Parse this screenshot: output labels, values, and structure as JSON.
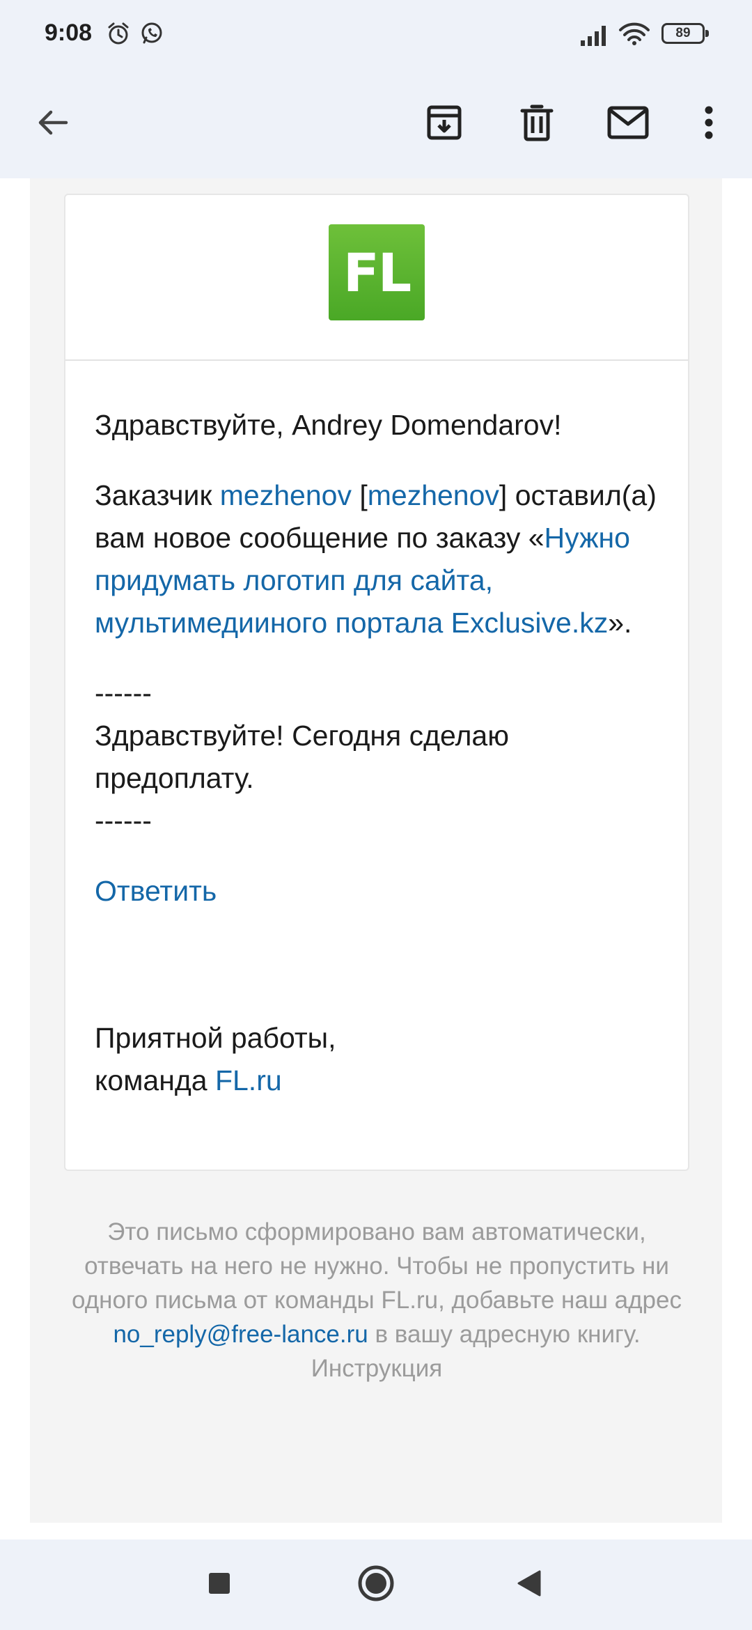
{
  "status_bar": {
    "time": "9:08",
    "battery": "89",
    "icons": [
      "alarm-icon",
      "whatsapp-icon",
      "signal-icon",
      "wifi-icon",
      "battery-icon"
    ]
  },
  "app_bar": {
    "icons": [
      "back-arrow-icon",
      "archive-icon",
      "delete-icon",
      "mark-unread-icon",
      "more-vert-icon"
    ]
  },
  "email": {
    "logo_text": "FL",
    "greeting": "Здравствуйте, Andrey Domendarov!",
    "msg_prefix": "Заказчик ",
    "client_name": "mezhenov",
    "bracket_open": " [",
    "client_login": "mezhenov",
    "bracket_close": "]",
    "msg_middle": " оставил(а) вам новое сообщение по заказу «",
    "order_title": "Нужно придумать логотип для сайта, мультимедииного портала Exclusive.kz",
    "msg_end": "».",
    "separator": "------",
    "client_message": "Здравствуйте! Сегодня сделаю предоплату.",
    "reply_link": "Ответить",
    "signoff_line1": "Приятной работы,",
    "signoff_prefix": "команда ",
    "signoff_link": "FL.ru"
  },
  "footer": {
    "text1": "Это письмо сформировано вам автоматически, отвечать на него не нужно. Чтобы не пропустить ни одного письма от команды FL.ru, добавьте наш адрес ",
    "email_link": "no_reply@free-lance.ru",
    "text2": " в вашу адресную книгу.",
    "instruction": "Инструкция"
  },
  "nav_bar": {
    "icons": [
      "recents-icon",
      "home-icon",
      "back-icon"
    ]
  },
  "colors": {
    "link": "#1467a8",
    "bar_bg": "#eef2f9",
    "logo_green": "#4aa826"
  }
}
